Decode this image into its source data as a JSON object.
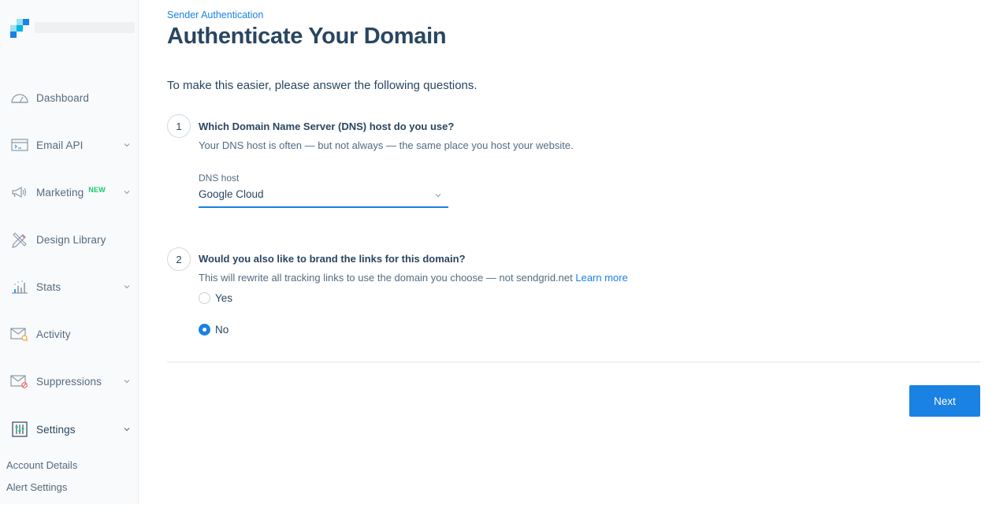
{
  "brand": {
    "logo_icon": "sendgrid-logo-icon",
    "accent": "#1a82e2",
    "new_badge_color": "#18c96e"
  },
  "sidebar": {
    "items": [
      {
        "label": "Dashboard",
        "icon": "gauge-icon",
        "expandable": false
      },
      {
        "label": "Email API",
        "icon": "terminal-window-icon",
        "expandable": true
      },
      {
        "label": "Marketing",
        "icon": "megaphone-icon",
        "expandable": true,
        "badge": "NEW"
      },
      {
        "label": "Design Library",
        "icon": "pencil-ruler-icon",
        "expandable": false
      },
      {
        "label": "Stats",
        "icon": "bar-chart-icon",
        "expandable": true
      },
      {
        "label": "Activity",
        "icon": "envelope-search-icon",
        "expandable": false
      },
      {
        "label": "Suppressions",
        "icon": "envelope-block-icon",
        "expandable": true
      },
      {
        "label": "Settings",
        "icon": "sliders-icon",
        "expandable": true
      }
    ],
    "settings_subitems": [
      "Account Details",
      "Alert Settings"
    ]
  },
  "main": {
    "breadcrumb": "Sender Authentication",
    "title": "Authenticate Your Domain",
    "intro": "To make this easier, please answer the following questions.",
    "step1": {
      "number": "1",
      "title": "Which Domain Name Server (DNS) host do you use?",
      "description": "Your DNS host is often — but not always — the same place you host your website.",
      "field_label": "DNS host",
      "selected": "Google Cloud"
    },
    "step2": {
      "number": "2",
      "title": "Would you also like to brand the links for this domain?",
      "description": "This will rewrite all tracking links to use the domain you choose — not sendgrid.net",
      "learn_more": "Learn more",
      "options": [
        {
          "label": "Yes",
          "checked": false
        },
        {
          "label": "No",
          "checked": true
        }
      ]
    },
    "next_label": "Next"
  }
}
